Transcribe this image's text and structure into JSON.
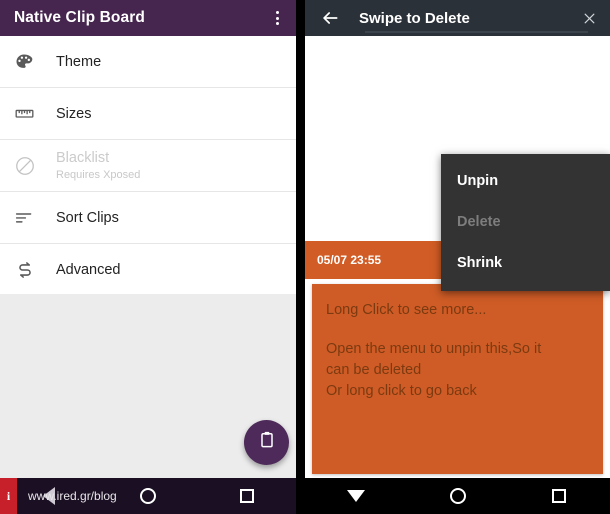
{
  "left_phone": {
    "appbar": {
      "title": "Native Clip Board",
      "overflow_icon": "dots-vertical-icon",
      "background": "#46254f"
    },
    "settings_list": [
      {
        "icon": "palette-icon",
        "label": "Theme",
        "subtitle": "",
        "disabled": false
      },
      {
        "icon": "ruler-icon",
        "label": "Sizes",
        "subtitle": "",
        "disabled": false
      },
      {
        "icon": "block-icon",
        "label": "Blacklist",
        "subtitle": "Requires Xposed",
        "disabled": true
      },
      {
        "icon": "sort-icon",
        "label": "Sort Clips",
        "subtitle": "",
        "disabled": false
      },
      {
        "icon": "advanced-icon",
        "label": "Advanced",
        "subtitle": "",
        "disabled": false
      }
    ],
    "fab": {
      "icon": "clipboard-icon",
      "color": "#4d2a59"
    },
    "navbar": {
      "back_icon": "triangle-back-icon",
      "home_icon": "circle-home-icon",
      "recents_icon": "square-recents-icon",
      "background": "#1b1023"
    },
    "watermark": {
      "badge": "i",
      "text": "www.ired.gr/blog",
      "badge_color": "#c8202a"
    }
  },
  "right_phone": {
    "appbar": {
      "back_icon": "arrow-left-icon",
      "title": "Swipe to Delete",
      "close_icon": "close-x-icon",
      "background": "#2b3138"
    },
    "popup_menu": {
      "items": [
        {
          "label": "Unpin",
          "disabled": false
        },
        {
          "label": "Delete",
          "disabled": true
        },
        {
          "label": "Shrink",
          "disabled": false
        }
      ],
      "background": "#333333"
    },
    "clip_card": {
      "timestamp": "05/07 23:55",
      "overflow_icon": "dots-vertical-icon",
      "header_color": "#d15c25",
      "body_color": "#cf5c26",
      "text_color": "#7c3a10",
      "lines": [
        "Long Click to see more...",
        "Open the menu to unpin this,So it",
        "can be deleted",
        "Or long click to go back"
      ]
    },
    "navbar": {
      "back_icon": "triangle-down-icon",
      "home_icon": "circle-home-icon",
      "recents_icon": "square-recents-icon",
      "background": "#000000"
    }
  }
}
